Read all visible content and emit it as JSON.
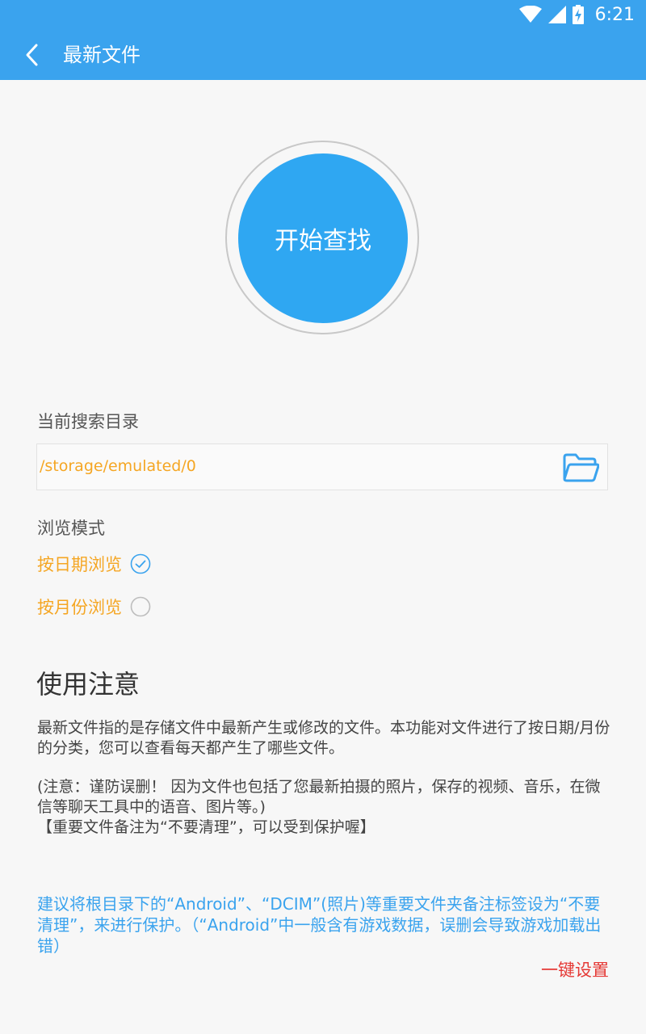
{
  "status_bar": {
    "time": "6:21",
    "icons": [
      "wifi-icon",
      "signal-icon",
      "battery-charging-icon"
    ]
  },
  "toolbar": {
    "back_icon": "chevron-left-icon",
    "title": "最新文件"
  },
  "search_button": {
    "label": "开始查找"
  },
  "search_dir": {
    "label": "当前搜索目录",
    "path": "/storage/emulated/0",
    "folder_icon": "folder-open-icon"
  },
  "browse_mode": {
    "label": "浏览模式",
    "options": [
      {
        "label": "按日期浏览",
        "checked": true
      },
      {
        "label": "按月份浏览",
        "checked": false
      }
    ]
  },
  "notes": {
    "title": "使用注意",
    "para1": "最新文件指的是存储文件中最新产生或修改的文件。本功能对文件进行了按日期/月份的分类，您可以查看每天都产生了哪些文件。",
    "para2": "(注意：谨防误删！ 因为文件也包括了您最新拍摄的照片，保存的视频、音乐，在微信等聊天工具中的语音、图片等。)",
    "para3": "【重要文件备注为“不要清理”，可以受到保护喔】",
    "tip": "建议将根目录下的“Android”、“DCIM”(照片)等重要文件夹备注标签设为“不要清理”，来进行保护。（“Android”中一般含有游戏数据，误删会导致游戏加载出错）",
    "action": "一键设置"
  },
  "colors": {
    "primary": "#3aa3ee",
    "button": "#2fa7f2",
    "accent_orange": "#f5a623",
    "action_red": "#e53935"
  }
}
